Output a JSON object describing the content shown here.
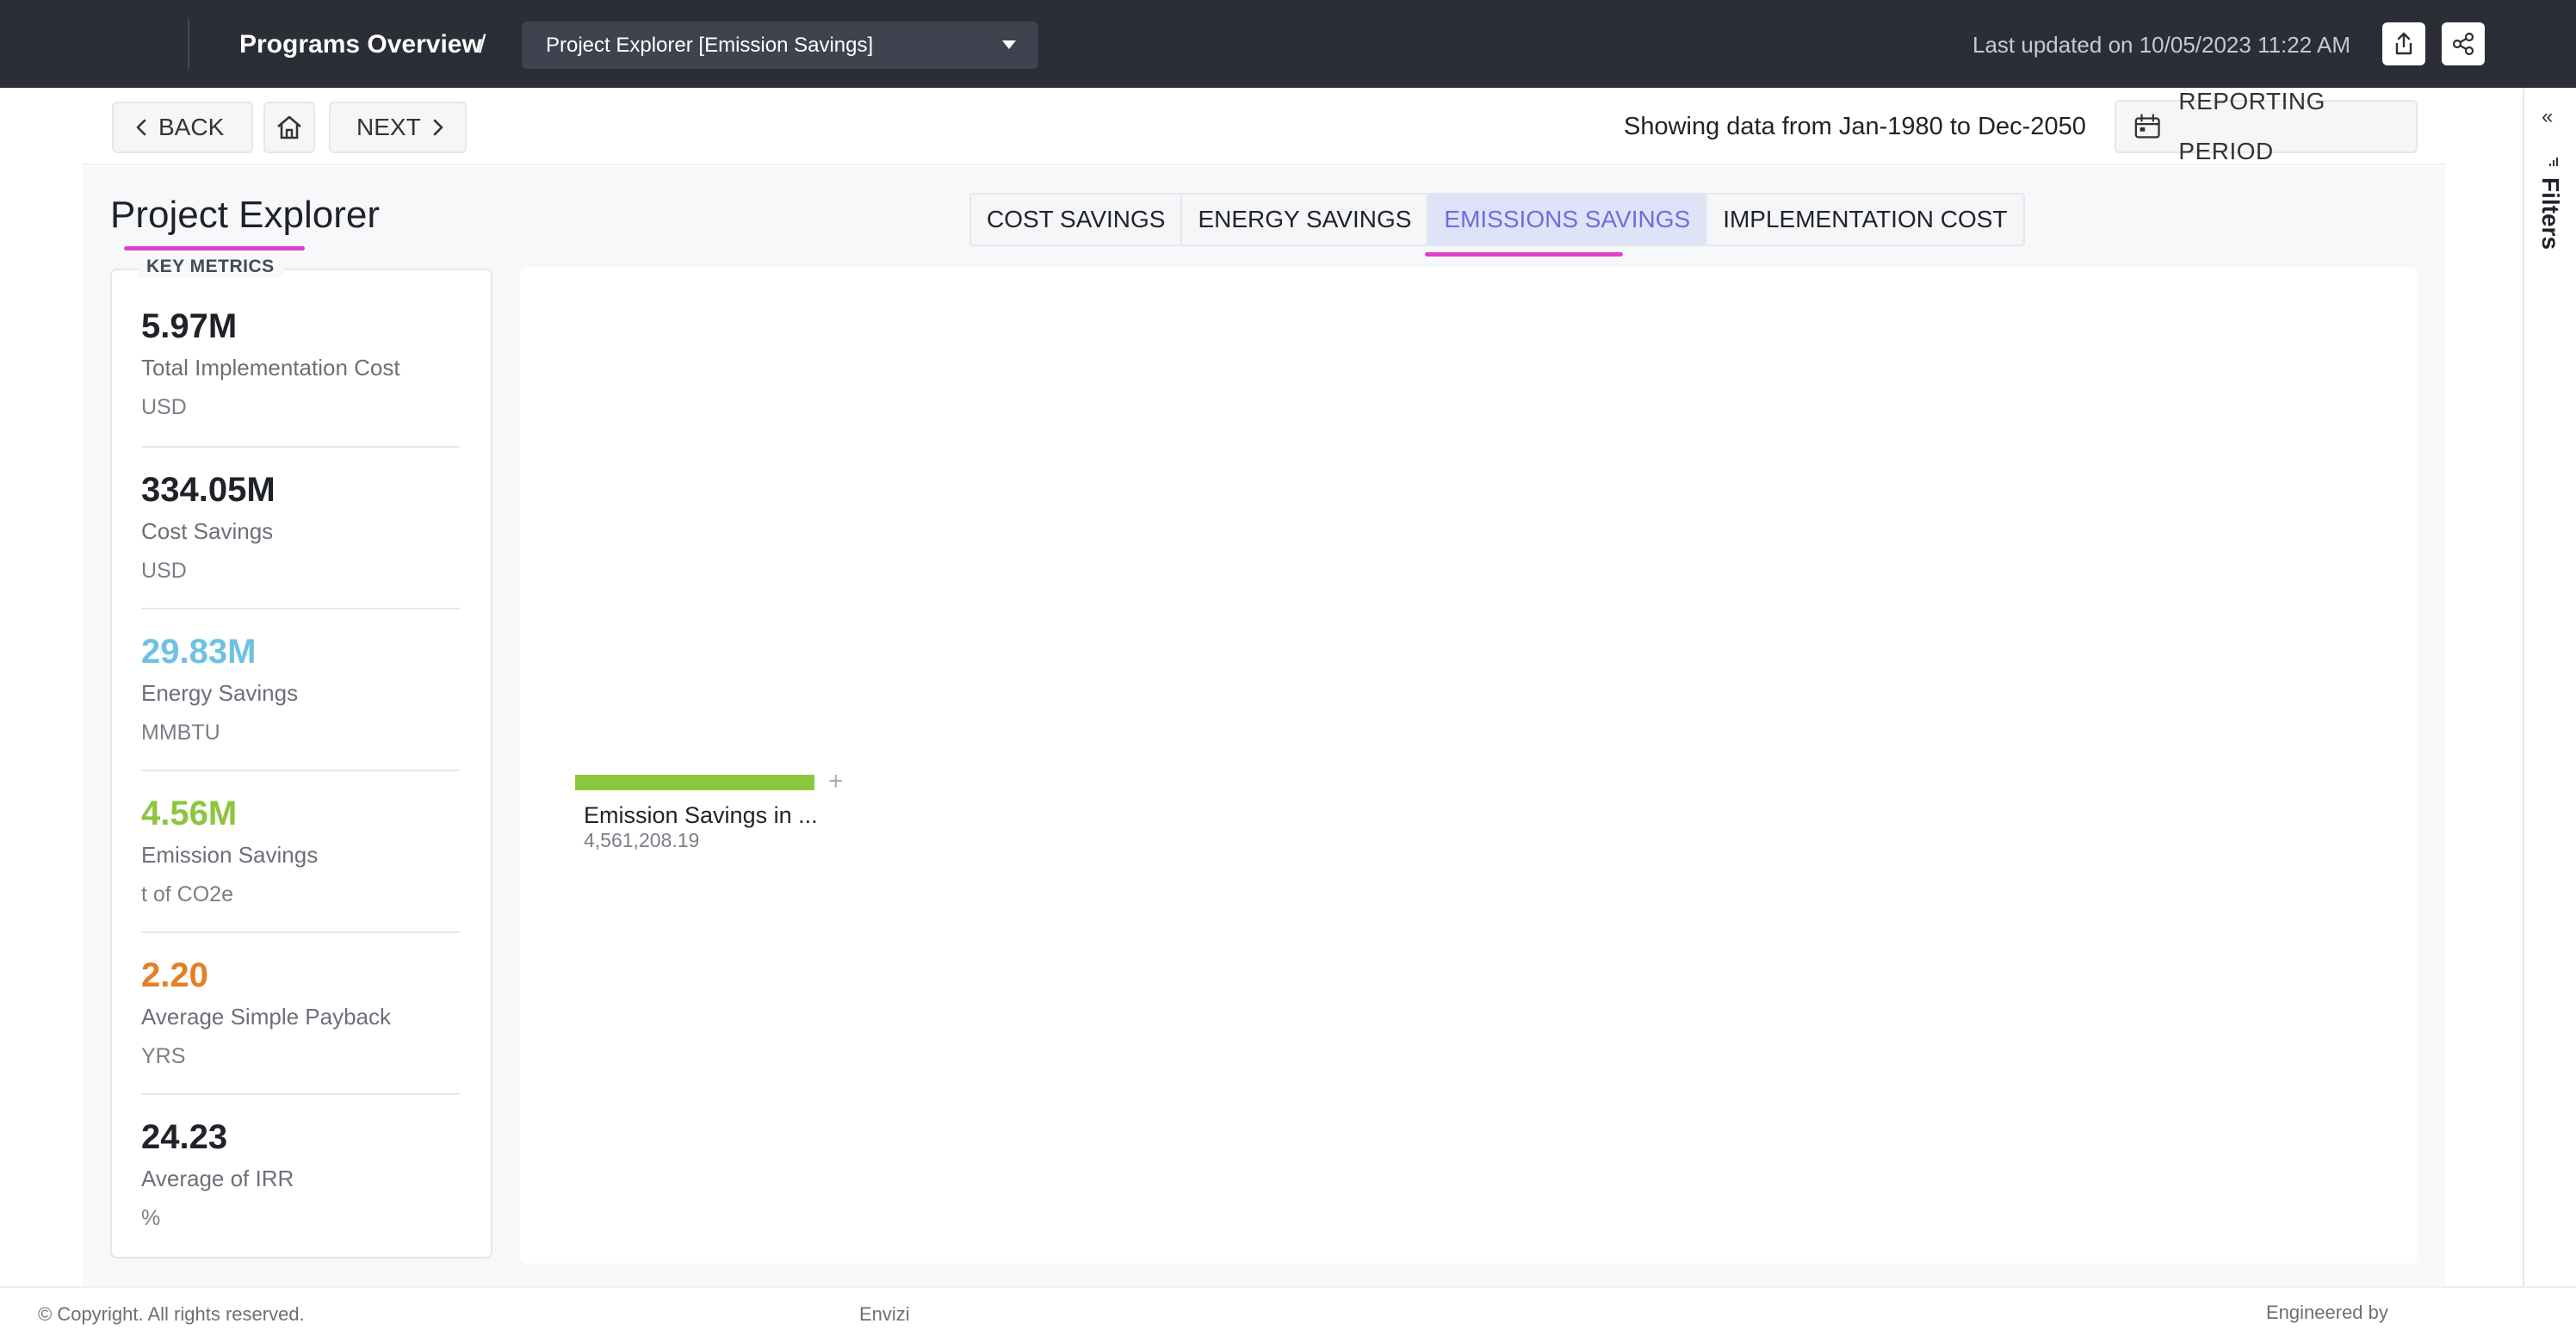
{
  "header": {
    "breadcrumb": "Programs Overview",
    "separator": "/",
    "selector_value": "Project Explorer [Emission Savings]",
    "last_updated": "Last updated on 10/05/2023 11:22 AM"
  },
  "toolbar": {
    "back_label": "BACK",
    "next_label": "NEXT",
    "showing": "Showing data from Jan-1980 to Dec-2050",
    "reporting_label": "REPORTING PERIOD"
  },
  "filters": {
    "label": "Filters",
    "collapse_glyph": "«"
  },
  "page": {
    "title": "Project Explorer"
  },
  "tabs": [
    {
      "label": "COST SAVINGS"
    },
    {
      "label": "ENERGY SAVINGS"
    },
    {
      "label": "EMISSIONS SAVINGS"
    },
    {
      "label": "IMPLEMENTATION COST"
    }
  ],
  "metrics": {
    "legend": "KEY METRICS",
    "items": [
      {
        "value": "5.97M",
        "label": "Total Implementation Cost",
        "unit": "USD",
        "color": "#1f2329"
      },
      {
        "value": "334.05M",
        "label": "Cost Savings",
        "unit": "USD",
        "color": "#1f2329"
      },
      {
        "value": "29.83M",
        "label": "Energy Savings",
        "unit": "MMBTU",
        "color": "#6ec1e4"
      },
      {
        "value": "4.56M",
        "label": "Emission Savings",
        "unit": "t of CO2e",
        "color": "#8cc63f"
      },
      {
        "value": "2.20",
        "label": "Average Simple Payback",
        "unit": "YRS",
        "color": "#e67e22"
      },
      {
        "value": "24.23",
        "label": "Average of IRR",
        "unit": "%",
        "color": "#1f2329"
      }
    ]
  },
  "chart_data": {
    "type": "bar",
    "categories": [
      "Emission Savings in ..."
    ],
    "values": [
      4561208.19
    ],
    "value_labels": [
      "4,561,208.19"
    ],
    "bar_color": "#8cc63f",
    "expand_glyph": "+"
  },
  "footer": {
    "copyright": "© Copyright. All rights reserved.",
    "brand": "Envizi",
    "engineered": "Engineered by"
  }
}
